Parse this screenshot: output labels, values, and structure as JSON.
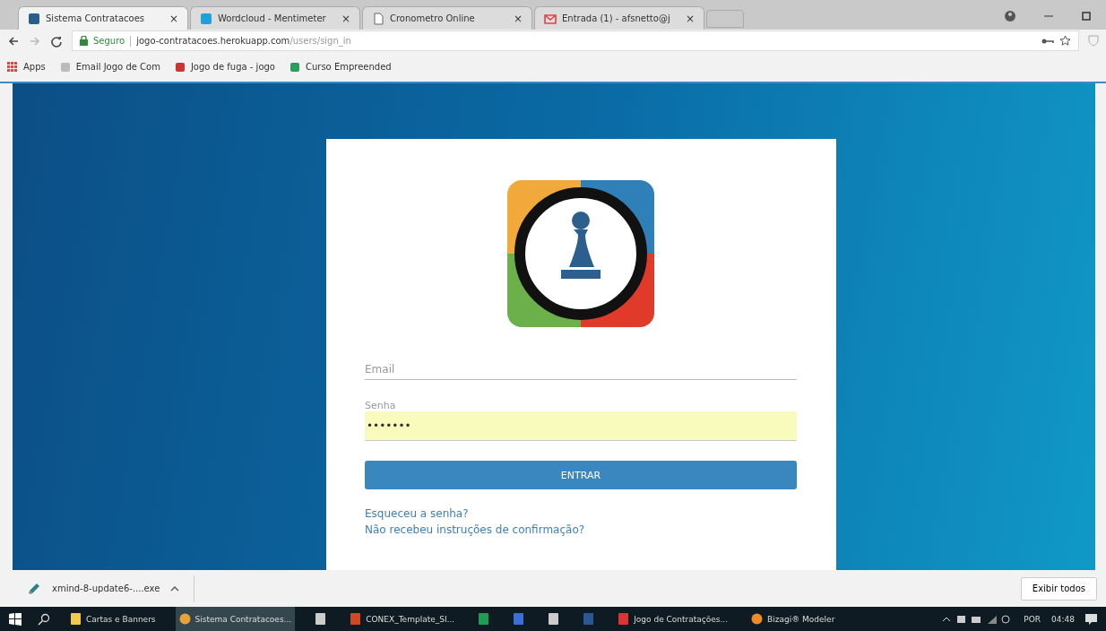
{
  "browser": {
    "tabs": [
      {
        "title": "Sistema Contratacoes",
        "selected": true,
        "kind": "app"
      },
      {
        "title": "Wordcloud - Mentimeter",
        "selected": false,
        "kind": "menti"
      },
      {
        "title": "Cronometro Online",
        "selected": false,
        "kind": "page"
      },
      {
        "title": "Entrada (1) - afsnetto@j",
        "selected": false,
        "kind": "mail"
      }
    ],
    "close_glyph": "×",
    "address": {
      "secure_label": "Seguro",
      "host": "jogo-contratacoes.herokuapp.com",
      "path": "/users/sign_in"
    },
    "bookmarks": [
      {
        "label": "Apps",
        "kind": "apps"
      },
      {
        "label": "Email Jogo de Com",
        "kind": "doc"
      },
      {
        "label": "Jogo de fuga - jogo",
        "kind": "red"
      },
      {
        "label": "Curso Empreended",
        "kind": "sheet"
      }
    ]
  },
  "login": {
    "email": {
      "placeholder": "Email"
    },
    "password": {
      "label": "Senha",
      "value": "•••••••",
      "autofilled": true
    },
    "submit": "ENTRAR",
    "links": [
      "Esqueceu a senha?",
      "Não recebeu instruções de confirmação?"
    ]
  },
  "downloads": {
    "file": "xmind-8-update6-....exe",
    "show_all": "Exibir todos"
  },
  "taskbar": {
    "items": [
      {
        "label": "Cartas e Banners",
        "kind": "folder",
        "selected": false
      },
      {
        "label": "Sistema Contratacoes...",
        "kind": "chrome",
        "selected": true
      },
      {
        "kind": "calc",
        "selected": false
      },
      {
        "label": "CONEX_Template_SI...",
        "kind": "ppt",
        "selected": false
      },
      {
        "kind": "excel",
        "selected": false
      },
      {
        "kind": "shield",
        "selected": false
      },
      {
        "kind": "calc",
        "selected": false
      },
      {
        "kind": "word",
        "selected": false
      },
      {
        "label": "Jogo de Contratações...",
        "kind": "pdf",
        "selected": false
      },
      {
        "label": "Bizagi® Modeler",
        "kind": "bizagi",
        "selected": false
      }
    ],
    "language": "POR",
    "time": "04:48"
  }
}
